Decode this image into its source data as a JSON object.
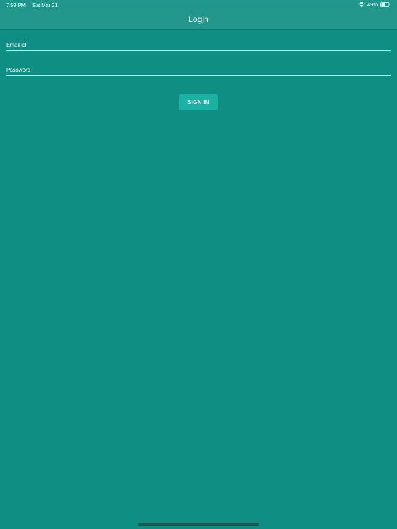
{
  "status_bar": {
    "time": "7:59 PM",
    "date": "Sat Mar 21",
    "battery_percent": "49%",
    "battery_level": 0.49,
    "wifi_icon": "wifi-icon",
    "battery_icon": "battery-icon"
  },
  "nav": {
    "title": "Login"
  },
  "form": {
    "email": {
      "placeholder": "Email id",
      "value": ""
    },
    "password": {
      "placeholder": "Password",
      "value": ""
    },
    "submit_label": "SIGN IN"
  },
  "colors": {
    "background": "#0f8f83",
    "header": "#23978c",
    "button": "#19b2a3",
    "text": "#ffffff"
  }
}
